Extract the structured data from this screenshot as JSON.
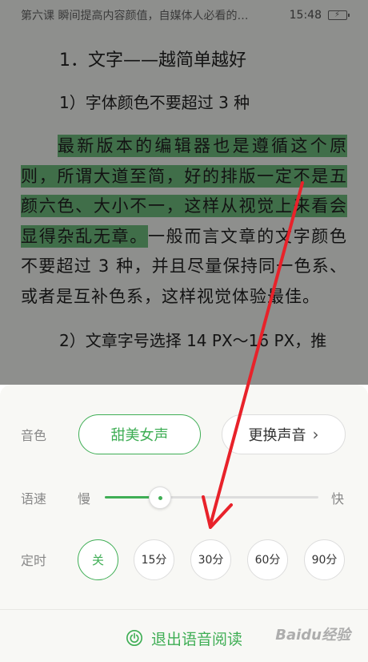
{
  "status_bar": {
    "title": "第六课 瞬间提高内容颜值，自媒体人必看的…",
    "time": "15:48",
    "battery_icon": "battery-charging-icon"
  },
  "article": {
    "heading": "1．文字——越简单越好",
    "subheading1": "1）字体颜色不要超过 3 种",
    "para_highlight": "最新版本的编辑器也是遵循这个原则，所谓大道至简，好的排版一定不是五颜六色、大小不一，这样从视觉上来看会显得杂乱无章。",
    "para_rest": "一般而言文章的文字颜色不要超过 3 种，并且尽量保持同一色系、或者是互补色系，这样视觉体验最佳。",
    "subheading2": "2）文章字号选择 14 PX～16 PX，推"
  },
  "panel": {
    "voice": {
      "label": "音色",
      "current": "甜美女声",
      "change": "更换声音",
      "chevron": "›"
    },
    "speed": {
      "label": "语速",
      "slow": "慢",
      "fast": "快",
      "level": 0.26
    },
    "timer": {
      "label": "定时",
      "options": [
        "关",
        "15分",
        "30分",
        "60分",
        "90分"
      ],
      "selected": 0
    },
    "exit_label": "退出语音阅读"
  },
  "watermark": "Baidu经验",
  "colors": {
    "accent": "#3fae55",
    "highlight": "#6fbd7e",
    "arrow": "#e8222a"
  }
}
